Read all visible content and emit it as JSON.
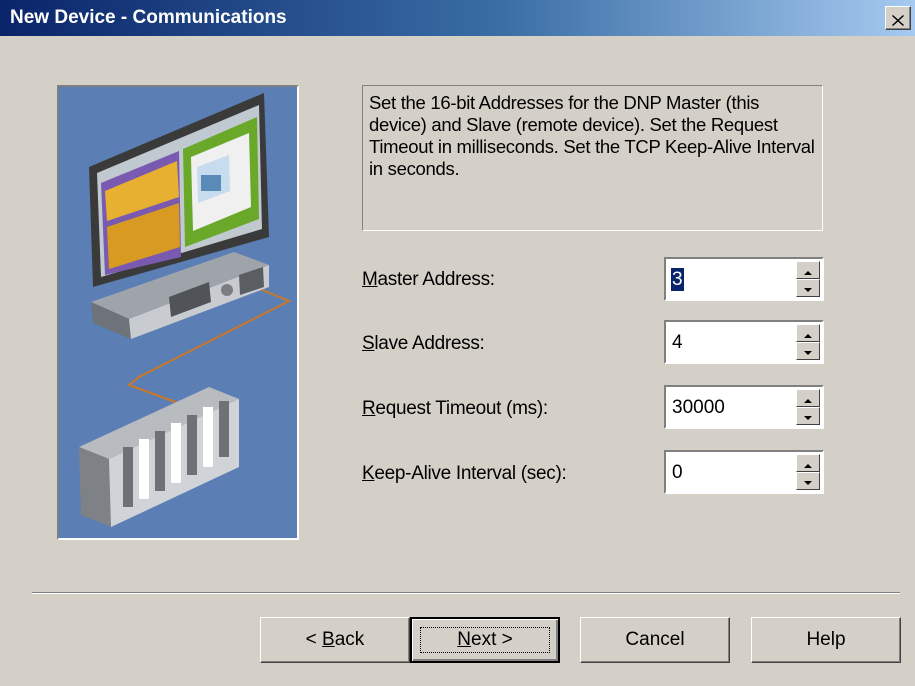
{
  "window": {
    "title": "New Device - Communications"
  },
  "description": "Set the 16-bit Addresses for the DNP Master (this device) and Slave (remote device).  Set the Request Timeout in milliseconds. Set the TCP Keep-Alive Interval in seconds.",
  "fields": [
    {
      "label_mnemonic": "M",
      "label_rest": "aster Address:",
      "value": "3"
    },
    {
      "label_mnemonic": "S",
      "label_rest": "lave Address:",
      "value": "4"
    },
    {
      "label_mnemonic": "R",
      "label_rest": "equest Timeout (ms):",
      "value": "30000"
    },
    {
      "label_mnemonic": "K",
      "label_rest": "eep-Alive Interval (sec):",
      "value": "0"
    }
  ],
  "buttons": {
    "back_prefix": "< ",
    "back_mnemonic": "B",
    "back_rest": "ack",
    "next_mnemonic": "N",
    "next_rest": "ext >",
    "cancel": "Cancel",
    "help": "Help"
  },
  "icons": {
    "close": "close-icon",
    "spin_up": "spin-up-arrow-icon",
    "spin_down": "spin-down-arrow-icon"
  },
  "colors": {
    "title_start": "#0a246a",
    "title_end": "#a6caf0",
    "face": "#d4d0c8",
    "illustration_bg": "#5b7fb4",
    "selection": "#0a246a"
  }
}
